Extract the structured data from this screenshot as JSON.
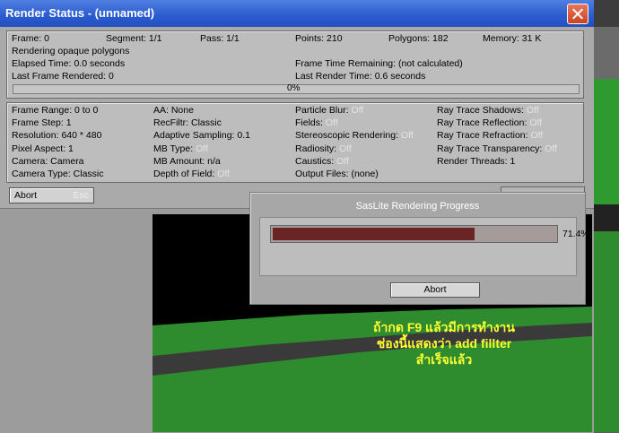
{
  "window": {
    "title": "Render Status - (unnamed)"
  },
  "status_panel": {
    "frame": "Frame: 0",
    "segment": "Segment: 1/1",
    "pass": "Pass: 1/1",
    "points": "Points: 210",
    "polygons": "Polygons: 182",
    "memory": "Memory: 31 K",
    "activity": "Rendering opaque polygons",
    "elapsed": "Elapsed Time: 0.0 seconds",
    "frame_time_remaining": "Frame Time Remaining: (not calculated)",
    "last_frame": "Last Frame Rendered: 0",
    "last_render_time": "Last Render Time: 0.6 seconds",
    "progress_text": "0%",
    "progress_fraction": 0
  },
  "settings": {
    "col1": [
      "Frame Range: 0 to 0",
      "Frame Step: 1",
      "Resolution: 640 * 480",
      "Pixel Aspect: 1",
      "Camera: Camera",
      "Camera Type: Classic"
    ],
    "col2": [
      "AA: None",
      "RecFiltr: Classic",
      "Adaptive Sampling: 0.1",
      "MB Type:",
      "MB Amount: n/a",
      "Depth of Field:"
    ],
    "col2_off": [
      "",
      "",
      "",
      "Off",
      "",
      "Off"
    ],
    "col3": [
      "Particle Blur:",
      "Fields:",
      "Stereoscopic Rendering:",
      "Radiosity:",
      "Caustics:",
      "Output Files: (none)"
    ],
    "col3_off": [
      "Off",
      "Off",
      "Off",
      "Off",
      "Off",
      ""
    ],
    "col4": [
      "Ray Trace Shadows:",
      "Ray Trace Reflection:",
      "Ray Trace Refraction:",
      "Ray Trace Transparency:",
      "Render Threads: 1"
    ],
    "col4_off": [
      "Off",
      "Off",
      "Off",
      "Off",
      ""
    ]
  },
  "abort_main": {
    "label": "Abort",
    "shortcut": "Esc"
  },
  "progress_dialog": {
    "title": "SasLite Rendering Progress",
    "percent_text": "71.4%",
    "fraction": 0.714,
    "abort_label": "Abort",
    "fill_color": "#6a2424"
  },
  "annotation": {
    "line1": "ถ้ากด F9 แล้วมีการทำงาน",
    "line2": "ช่องนี้แสดงว่า add fillter",
    "line3": "สำเร็จแล้ว",
    "color": "#ffff33"
  }
}
